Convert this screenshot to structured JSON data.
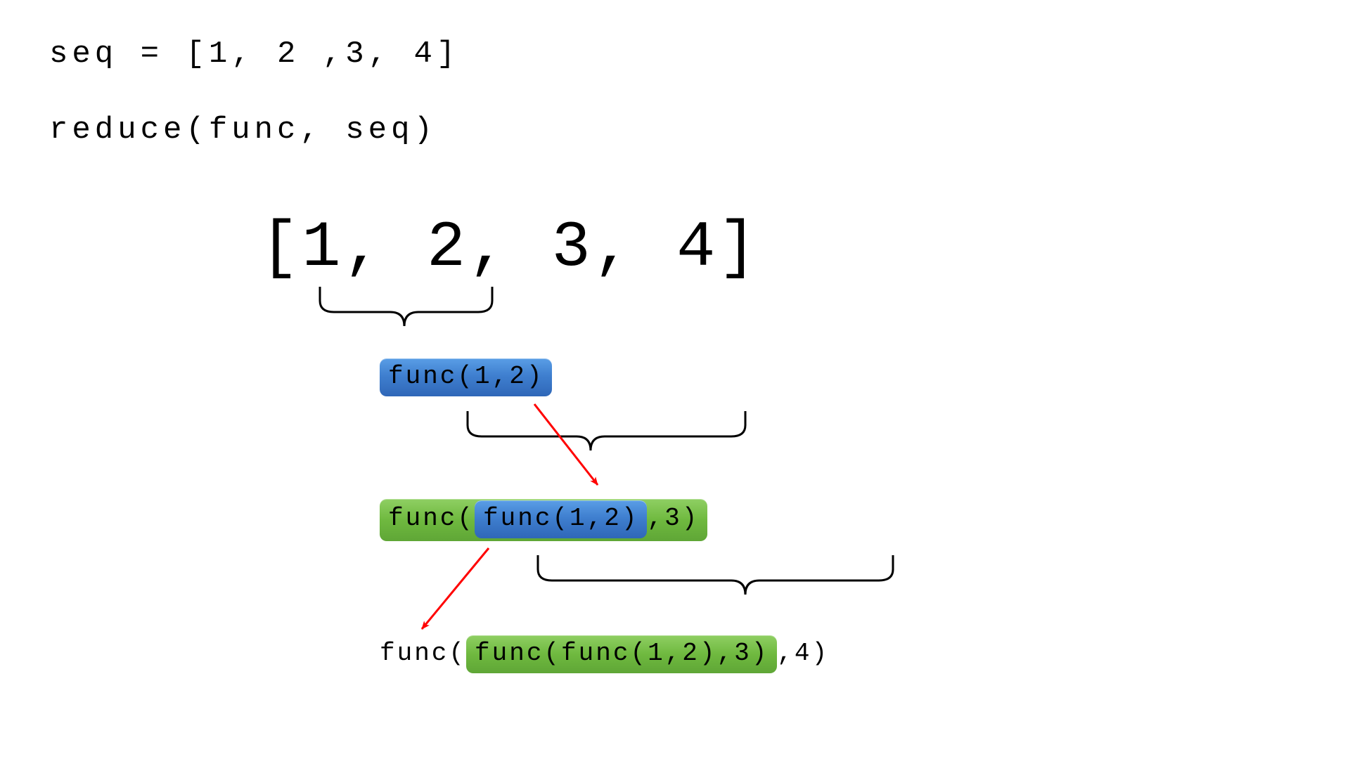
{
  "code": {
    "line1": "seq = [1, 2 ,3, 4]",
    "line2": "reduce(func, seq)"
  },
  "seq_display": "[1, 2, 3, 4]",
  "steps": {
    "step1": {
      "inner_blue": "func(1,2)"
    },
    "step2": {
      "prefix": "func(",
      "inner_blue": "func(1,2)",
      "suffix": ",3)"
    },
    "step3": {
      "prefix": "func(",
      "inner_green": "func(func(1,2),3)",
      "suffix": ",4)"
    }
  },
  "colors": {
    "blue": "#3f7fcf",
    "green": "#6fb93f",
    "arrow": "#ff0000",
    "brace": "#000000"
  }
}
